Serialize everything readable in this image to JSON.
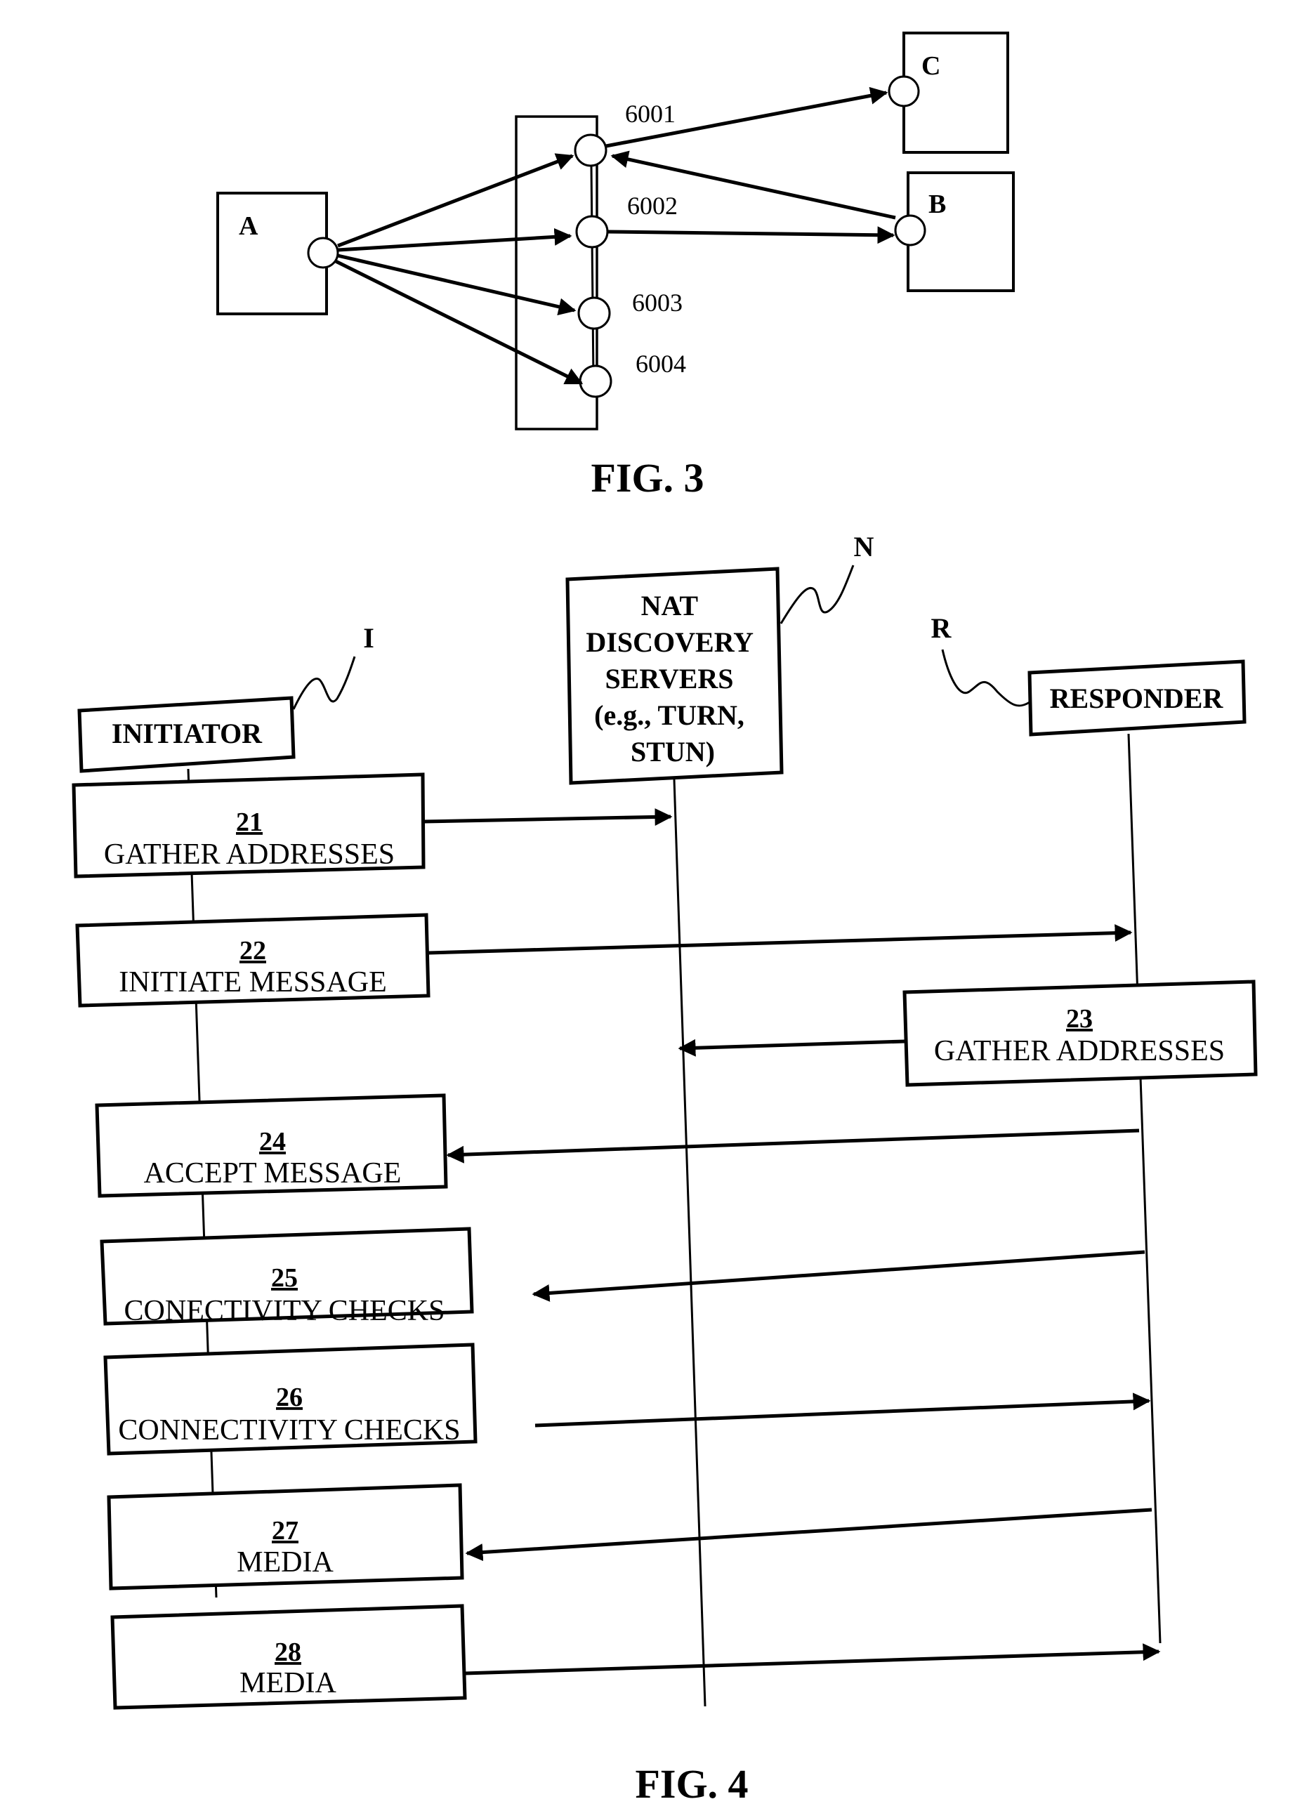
{
  "fig3": {
    "caption": "FIG. 3",
    "nodes": {
      "a_label": "A",
      "b_label": "B",
      "c_label": "C"
    },
    "ports": [
      "6001",
      "6002",
      "6003",
      "6004"
    ]
  },
  "fig4": {
    "caption": "FIG. 4",
    "initiator": {
      "label": "INITIATOR",
      "ref": "I"
    },
    "nat": {
      "lines": [
        "NAT",
        "DISCOVERY",
        "SERVERS",
        "(e.g., TURN,",
        "STUN)"
      ],
      "ref": "N"
    },
    "responder": {
      "label": "RESPONDER",
      "ref": "R"
    },
    "steps": [
      {
        "num": "21",
        "text": "GATHER ADDRESSES"
      },
      {
        "num": "22",
        "text": "INITIATE MESSAGE"
      },
      {
        "num": "23",
        "text": "GATHER ADDRESSES"
      },
      {
        "num": "24",
        "text": "ACCEPT MESSAGE"
      },
      {
        "num": "25",
        "text": "CONECTIVITY CHECKS"
      },
      {
        "num": "26",
        "text": "CONNECTIVITY CHECKS"
      },
      {
        "num": "27",
        "text": "MEDIA"
      },
      {
        "num": "28",
        "text": "MEDIA"
      }
    ]
  }
}
